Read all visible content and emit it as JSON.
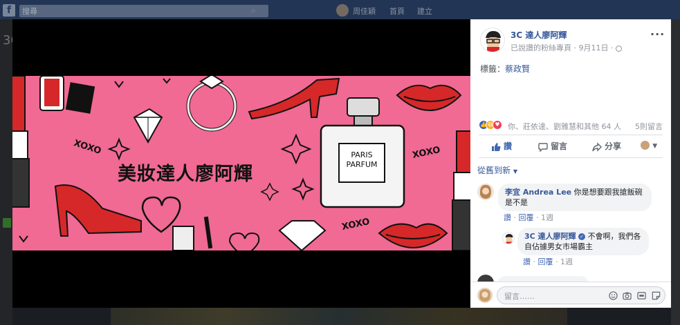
{
  "topbar": {
    "search_placeholder": "搜尋",
    "user_name": "周佳穎",
    "home_label": "首頁",
    "create_label": "建立"
  },
  "background_page": {
    "title_fragment": "3C"
  },
  "photo": {
    "title": "美妝達人廖阿輝",
    "xoxo_1": "XOXO",
    "xoxo_2": "XOXO",
    "xoxo_3": "XOXO",
    "perfume_line1": "PARIS",
    "perfume_line2": "PARFUM",
    "background_color": "#f06a93"
  },
  "post": {
    "page_name": "3C 達人廖阿輝",
    "subtitle": "已說讚的粉絲專頁 · 9月11日 · ",
    "tag_label": "標籤：",
    "tag_value": "蔡政賢",
    "reactions_text": "你、莊依達、劉雅慧和其他 64 人",
    "comments_count": "5則留言",
    "reaction_icons": [
      "like-icon",
      "haha-icon",
      "love-icon"
    ]
  },
  "actions": {
    "like": "讚",
    "comment": "留言",
    "share": "分享"
  },
  "comments": {
    "sort_label": "從舊到新",
    "items": [
      {
        "author": "李宜 Andrea Lee",
        "text": "你是想要跟我搶飯碗是不是",
        "like": "讚",
        "reply": "回覆",
        "time": "1週"
      },
      {
        "author": "3C 達人廖阿輝",
        "text": "不會啊，我們各自佔據男女市場霸主",
        "like": "讚",
        "reply": "回覆",
        "time": "1週"
      }
    ]
  },
  "composer": {
    "placeholder": "留言……",
    "icons": [
      "emoji-icon",
      "camera-icon",
      "gif-icon",
      "sticker-icon"
    ]
  },
  "colors": {
    "link": "#365899",
    "like_blue": "#4267b2",
    "photo_pink": "#f06a93"
  }
}
